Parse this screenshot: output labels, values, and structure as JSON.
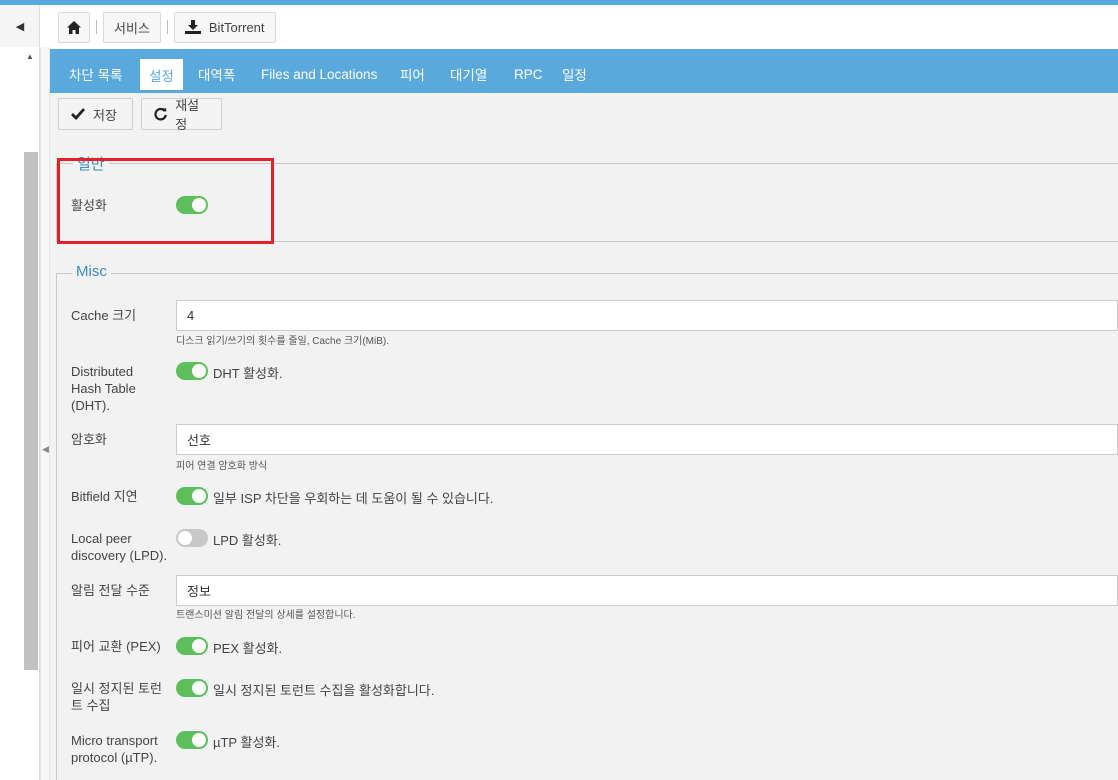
{
  "breadcrumb": {
    "home_icon": "home-icon",
    "items": [
      "서비스",
      "BitTorrent"
    ],
    "download_icon": "download-icon"
  },
  "tabs": [
    "차단 목록",
    "설정",
    "대역폭",
    "Files and Locations",
    "피어",
    "대기열",
    "RPC",
    "일정"
  ],
  "active_tab": "설정",
  "toolbar": {
    "save_label": "저장",
    "reset_label": "재설정"
  },
  "general": {
    "legend": "일반",
    "enable_label": "활성화",
    "enable_on": true
  },
  "misc": {
    "legend": "Misc",
    "cache_label": "Cache 크기",
    "cache_value": "4",
    "cache_help": "디스크 읽기/쓰기의 횟수를 줄일, Cache 크기(MiB).",
    "dht_label_1": "Distributed",
    "dht_label_2": "Hash Table",
    "dht_label_3": "(DHT).",
    "dht_desc": "DHT 활성화.",
    "dht_on": true,
    "encryption_label": "암호화",
    "encryption_value": "선호",
    "encryption_help": "피어 연결 암호화 방식",
    "bitfield_label": "Bitfield 지연",
    "bitfield_desc": "일부 ISP 차단을 우회하는 데 도움이 될 수 있습니다.",
    "bitfield_on": true,
    "lpd_label_1": "Local peer",
    "lpd_label_2": "discovery (LPD).",
    "lpd_desc": "LPD 활성화.",
    "lpd_on": false,
    "alert_label": "알림 전달 수준",
    "alert_value": "정보",
    "alert_help": "트랜스미션 알림 전달의 상세를 설정합니다.",
    "pex_label": "피어 교환 (PEX)",
    "pex_desc": "PEX 활성화.",
    "pex_on": true,
    "paused_label_1": "일시 정지된 토런",
    "paused_label_2": "트 수집",
    "paused_desc": "일시 정지된 토런트 수집을 활성화합니다.",
    "paused_on": true,
    "utp_label_1": "Micro transport",
    "utp_label_2": "protocol (µTP).",
    "utp_desc": "µTP 활성화.",
    "utp_on": true
  },
  "colors": {
    "accent": "#5aa9dc",
    "toggle_on": "#5cbf5c",
    "highlight": "#e32228"
  }
}
